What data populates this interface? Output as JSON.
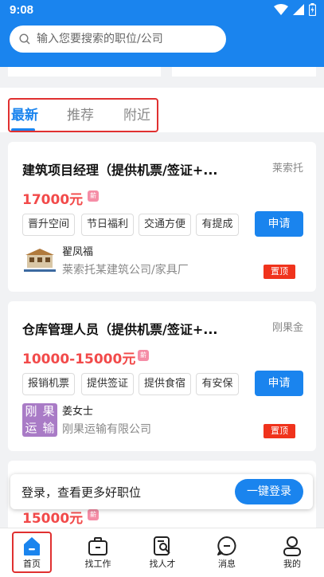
{
  "status_bar": {
    "time": "9:08"
  },
  "search": {
    "placeholder": "输入您要搜索的职位/公司"
  },
  "tabs": [
    {
      "label": "最新",
      "active": true
    },
    {
      "label": "推荐",
      "active": false
    },
    {
      "label": "附近",
      "active": false
    }
  ],
  "jobs": [
    {
      "title": "建筑项目经理（提供机票/签证+...",
      "company_short": "莱索托",
      "salary": "17000元",
      "tags": [
        "晋升空间",
        "节日福利",
        "交通方便",
        "有提成"
      ],
      "apply_label": "申请",
      "recruiter_name": "翟凤福",
      "recruiter_company": "莱索托某建筑公司/家具厂",
      "pin_label": "置顶"
    },
    {
      "title": "仓库管理人员（提供机票/签证+...",
      "company_short": "刚果金",
      "salary": "10000-15000元",
      "tags": [
        "报销机票",
        "提供签证",
        "提供食宿",
        "有安保"
      ],
      "apply_label": "申请",
      "recruiter_name": "姜女士",
      "recruiter_company": "刚果运输有限公司",
      "recruiter_logo_text": [
        "刚",
        "果",
        "运",
        "输"
      ],
      "pin_label": "置顶"
    },
    {
      "salary": "15000元"
    }
  ],
  "login_prompt": {
    "text": "登录，查看更多好职位",
    "button": "一键登录"
  },
  "bottom_nav": [
    {
      "label": "首页",
      "icon": "home-icon",
      "active": true
    },
    {
      "label": "找工作",
      "icon": "briefcase-icon",
      "active": false
    },
    {
      "label": "找人才",
      "icon": "talent-search-icon",
      "active": false
    },
    {
      "label": "消息",
      "icon": "message-icon",
      "active": false
    },
    {
      "label": "我的",
      "icon": "profile-icon",
      "active": false
    }
  ],
  "colors": {
    "brand": "#1a84ee",
    "salary": "#f24a4a",
    "pin": "#f0331c",
    "highlight": "#e03030"
  }
}
